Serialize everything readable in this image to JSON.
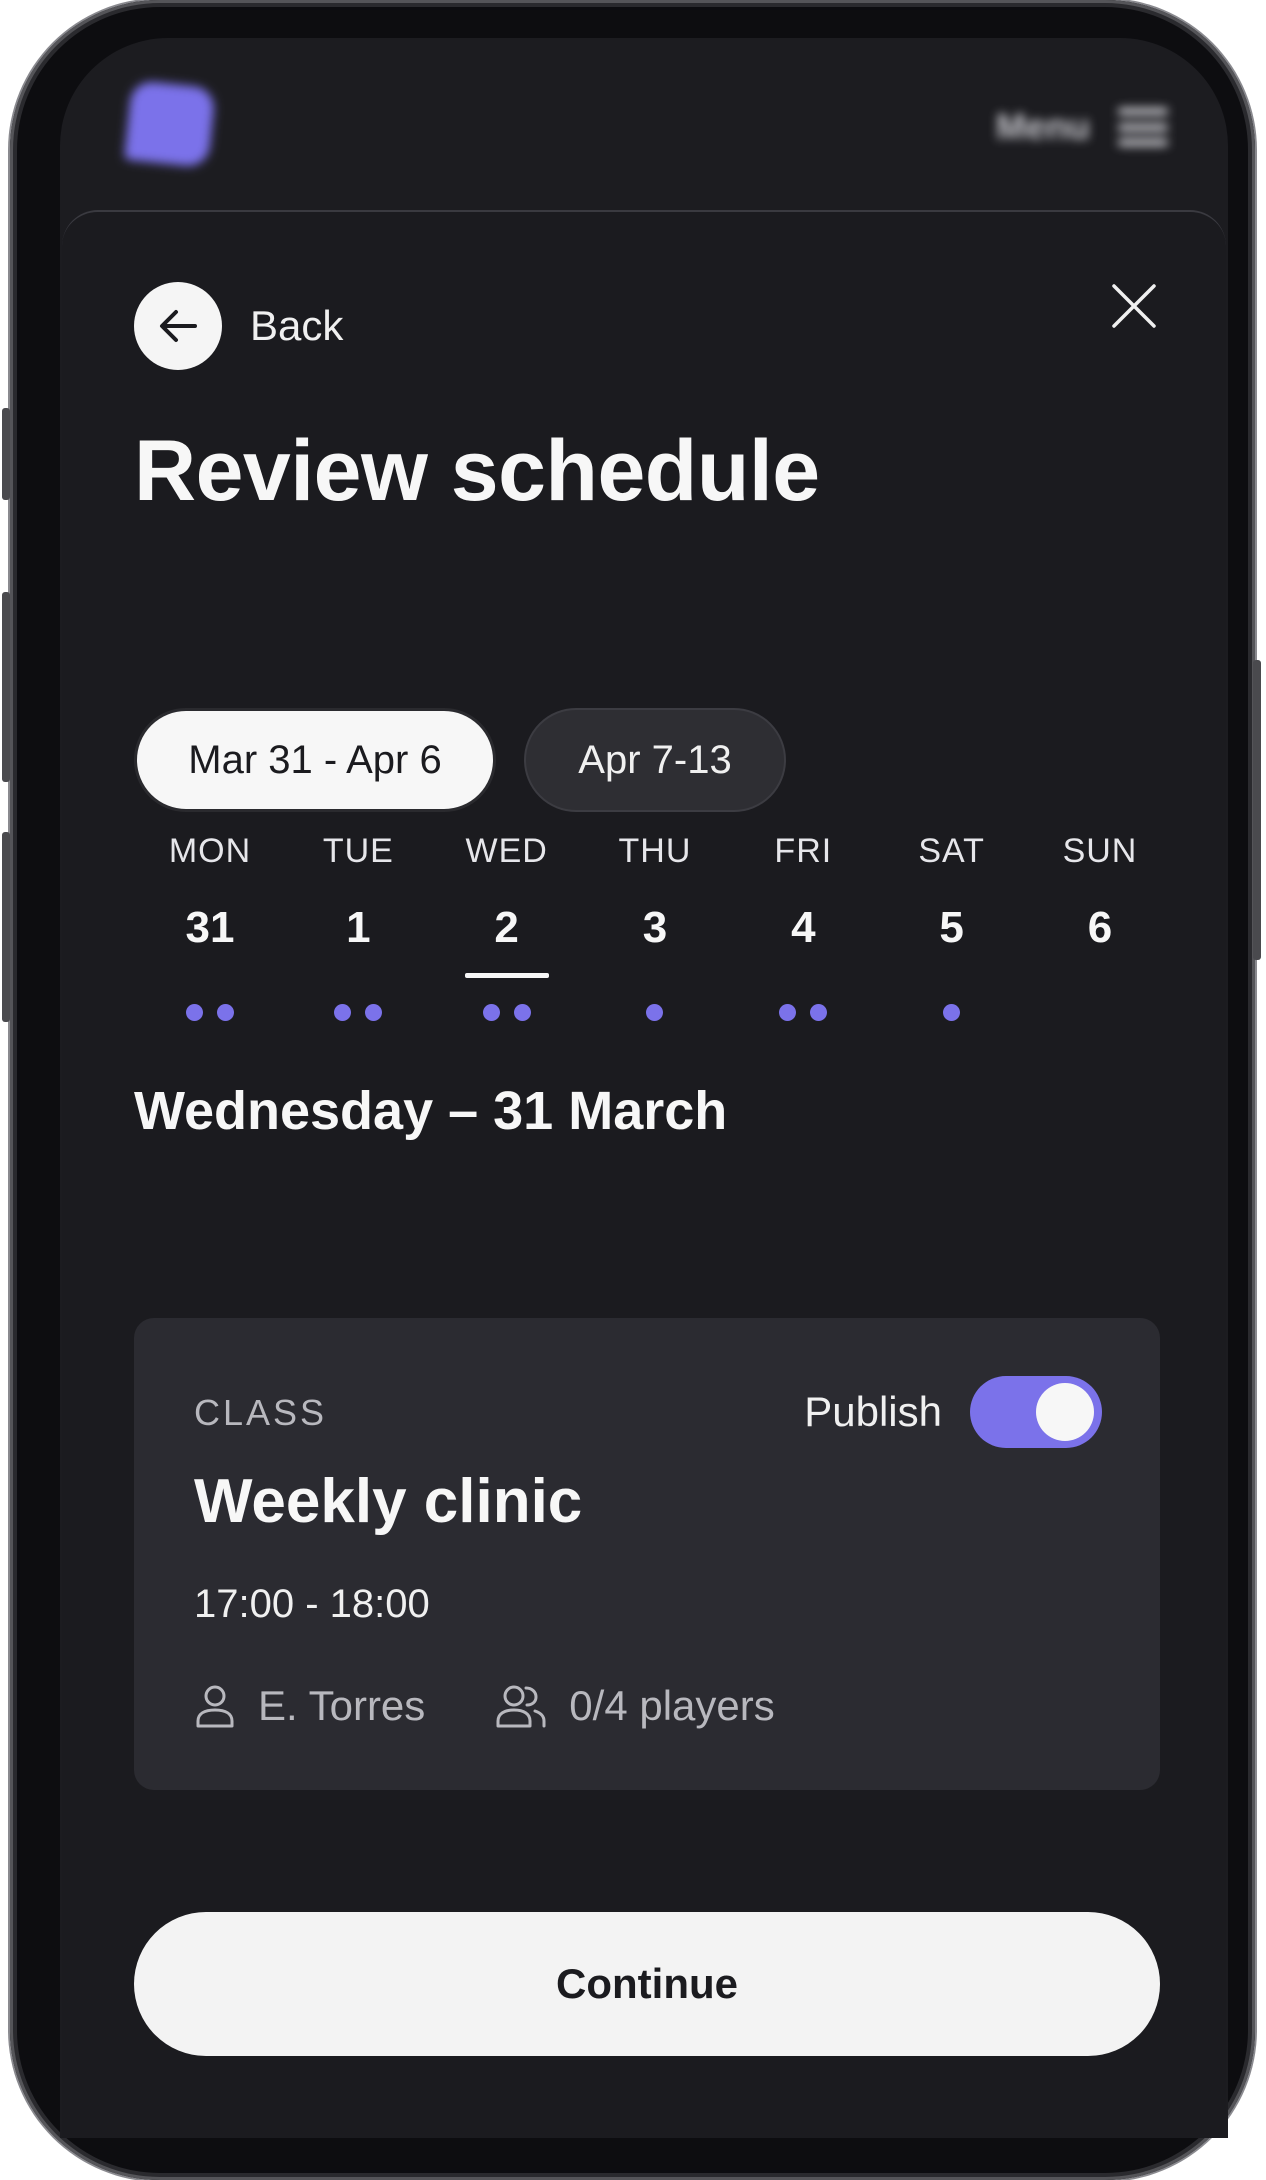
{
  "topbar": {
    "menu_label": "Menu"
  },
  "header": {
    "back_label": "Back",
    "title": "Review schedule"
  },
  "weeks": [
    {
      "label": "Mar 31 - Apr 6",
      "active": true
    },
    {
      "label": "Apr 7-13",
      "active": false
    }
  ],
  "days": [
    {
      "name": "MON",
      "num": "31",
      "dots": 2
    },
    {
      "name": "TUE",
      "num": "1",
      "dots": 2
    },
    {
      "name": "WED",
      "num": "2",
      "dots": 2,
      "selected": true
    },
    {
      "name": "THU",
      "num": "3",
      "dots": 1
    },
    {
      "name": "FRI",
      "num": "4",
      "dots": 2
    },
    {
      "name": "SAT",
      "num": "5",
      "dots": 1
    },
    {
      "name": "SUN",
      "num": "6",
      "dots": 0
    }
  ],
  "selected_date_heading": "Wednesday – 31 March",
  "session": {
    "type": "CLASS",
    "publish_label": "Publish",
    "publish_on": true,
    "title": "Weekly clinic",
    "time": "17:00 - 18:00",
    "coach": "E. Torres",
    "players": "0/4 players"
  },
  "continue_label": "Continue",
  "colors": {
    "accent": "#7b72ea",
    "background": "#1c1c20",
    "card": "#2b2b31",
    "text": "#f7f7f7"
  }
}
